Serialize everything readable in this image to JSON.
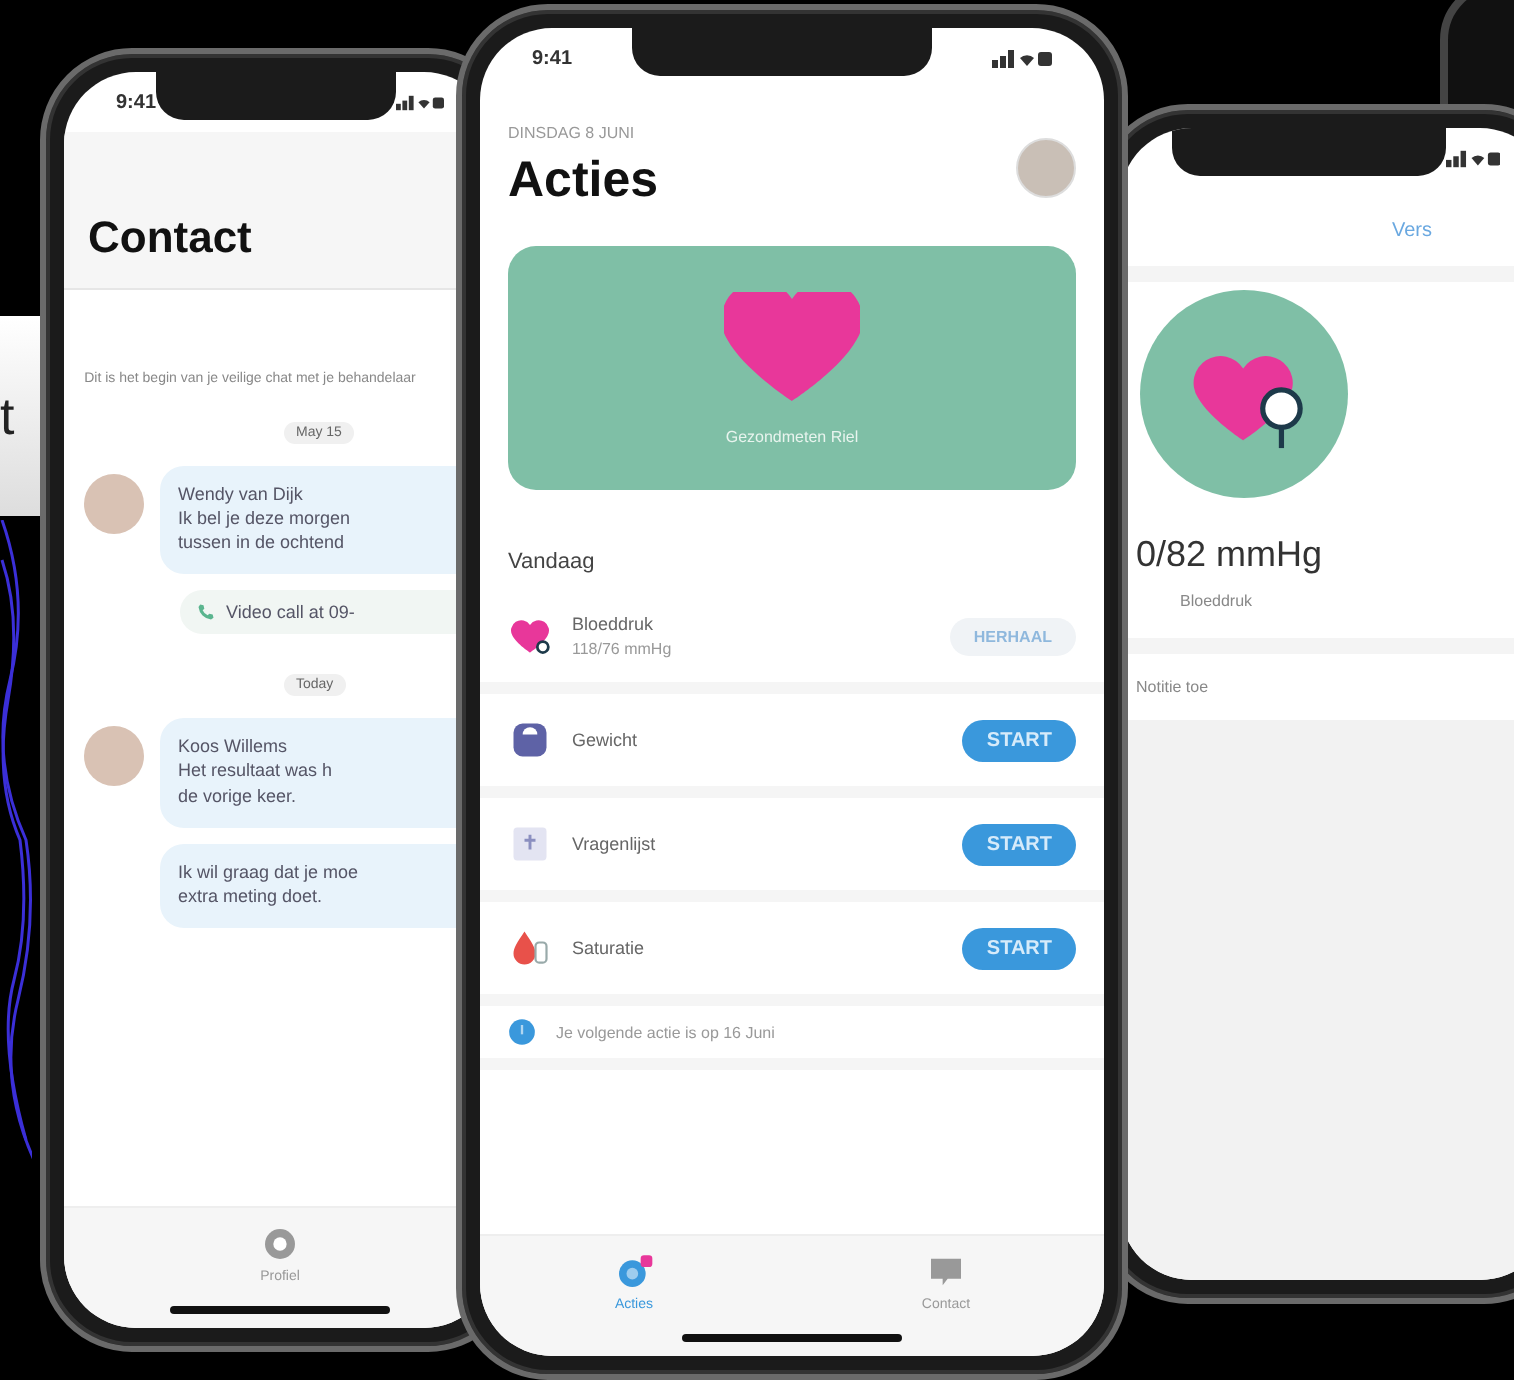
{
  "backdrop": {
    "text": "t"
  },
  "phones": [
    {
      "kind": "chat",
      "time": "9:41",
      "title": "Contact",
      "intro": "Dit is het begin van je veilige chat met je behandelaar",
      "items": [
        {
          "kind": "date",
          "text": "May 15"
        },
        {
          "kind": "message",
          "sender": "Wendy van Dijk",
          "lines": [
            "Ik bel je deze morgen",
            "tussen in de ochtend"
          ]
        },
        {
          "kind": "call",
          "text": "Video call at 09-"
        },
        {
          "kind": "date",
          "text": "Today"
        },
        {
          "kind": "message",
          "sender": "Koos Willems",
          "lines": [
            "Het resultaat was h",
            "de vorige keer."
          ]
        },
        {
          "kind": "message",
          "lines": [
            "Ik wil graag dat je moe",
            "extra meting doet."
          ]
        }
      ],
      "tabs": [
        {
          "label": "Profiel",
          "selected": false
        }
      ]
    },
    {
      "kind": "actions",
      "time": "9:41",
      "date": "DINSDAG 8 JUNI",
      "title": "Acties",
      "card": {
        "label": "Gezondmeten Riel"
      },
      "section": "Vandaag",
      "rows": [
        {
          "kind": "heart",
          "name": "Bloeddruk",
          "detail": "118/76 mmHg",
          "button": {
            "kind": "repeat",
            "label": "HERHAAL"
          }
        },
        {
          "kind": "scale",
          "name": "Gewicht",
          "button": {
            "kind": "start",
            "label": "START"
          }
        },
        {
          "kind": "clipboard",
          "name": "Vragenlijst",
          "button": {
            "kind": "start",
            "label": "START"
          }
        },
        {
          "kind": "drop",
          "name": "Saturatie",
          "button": {
            "kind": "start",
            "label": "START"
          }
        }
      ],
      "note": "Je volgende actie is op 16 Juni",
      "tabs": [
        {
          "label": "Acties",
          "selected": true
        },
        {
          "label": "Contact",
          "selected": false
        }
      ]
    },
    {
      "kind": "detail",
      "link": "Vers",
      "reading": "0/82 mmHg",
      "reading_label": "Bloeddruk",
      "action": "Notitie toe"
    }
  ]
}
